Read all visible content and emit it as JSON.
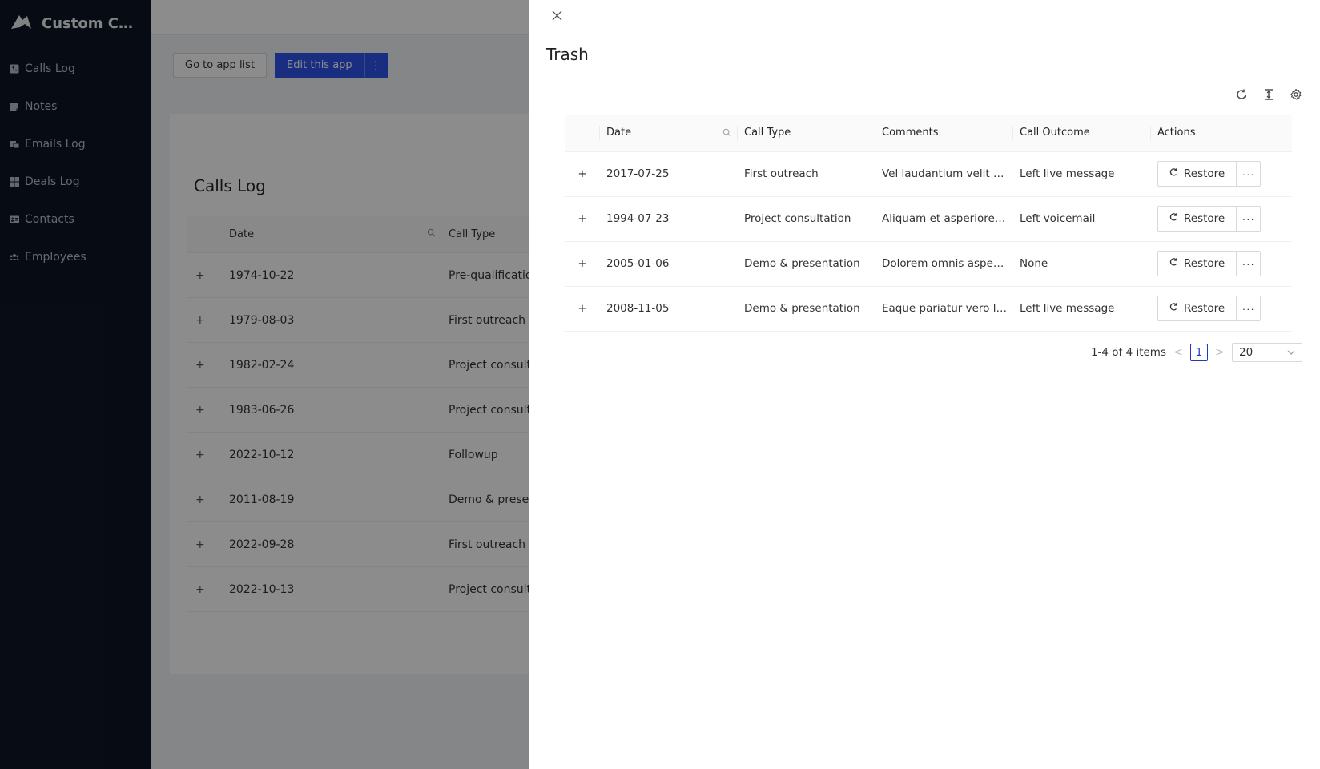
{
  "app": {
    "title": "Custom CR..."
  },
  "sidebar": {
    "items": [
      {
        "label": "Calls Log",
        "icon": "phone-icon"
      },
      {
        "label": "Notes",
        "icon": "note-icon"
      },
      {
        "label": "Emails Log",
        "icon": "email-icon"
      },
      {
        "label": "Deals Log",
        "icon": "grid-icon"
      },
      {
        "label": "Contacts",
        "icon": "contact-card-icon"
      },
      {
        "label": "Employees",
        "icon": "users-icon"
      }
    ]
  },
  "header_actions": {
    "go_to_app_list": "Go to app list",
    "edit_this_app": "Edit this app",
    "more": "⋮"
  },
  "background_page": {
    "title": "Calls Log",
    "columns": [
      "Date",
      "Call Type"
    ],
    "rows": [
      {
        "date": "1974-10-22",
        "call_type": "Pre-qualification"
      },
      {
        "date": "1979-08-03",
        "call_type": "First outreach"
      },
      {
        "date": "1982-02-24",
        "call_type": "Project consulta"
      },
      {
        "date": "1983-06-26",
        "call_type": "Project consulta"
      },
      {
        "date": "2022-10-12",
        "call_type": "Followup"
      },
      {
        "date": "2011-08-19",
        "call_type": "Demo & present"
      },
      {
        "date": "2022-09-28",
        "call_type": "First outreach"
      },
      {
        "date": "2022-10-13",
        "call_type": "Project consulta"
      }
    ]
  },
  "drawer": {
    "close": "X",
    "title": "Trash",
    "toolbar": [
      "refresh-icon",
      "column-height-icon",
      "settings-icon"
    ],
    "columns": {
      "date": "Date",
      "call_type": "Call Type",
      "comments": "Comments",
      "call_outcome": "Call Outcome",
      "actions": "Actions"
    },
    "rows": [
      {
        "expand": "+",
        "date": "2017-07-25",
        "call_type": "First outreach",
        "comments": "Vel laudantium velit d...",
        "call_outcome": "Left live message",
        "restore": "Restore",
        "more": "···"
      },
      {
        "expand": "+",
        "date": "1994-07-23",
        "call_type": "Project consultation",
        "comments": "Aliquam et asperiores ...",
        "call_outcome": "Left voicemail",
        "restore": "Restore",
        "more": "···"
      },
      {
        "expand": "+",
        "date": "2005-01-06",
        "call_type": "Demo & presentation",
        "comments": "Dolorem omnis asperi...",
        "call_outcome": "None",
        "restore": "Restore",
        "more": "···"
      },
      {
        "expand": "+",
        "date": "2008-11-05",
        "call_type": "Demo & presentation",
        "comments": "Eaque pariatur vero la...",
        "call_outcome": "Left live message",
        "restore": "Restore",
        "more": "···"
      }
    ],
    "pagination": {
      "summary": "1-4 of 4 items",
      "prev": "<",
      "current_page": "1",
      "next": ">",
      "page_size": "20"
    }
  }
}
